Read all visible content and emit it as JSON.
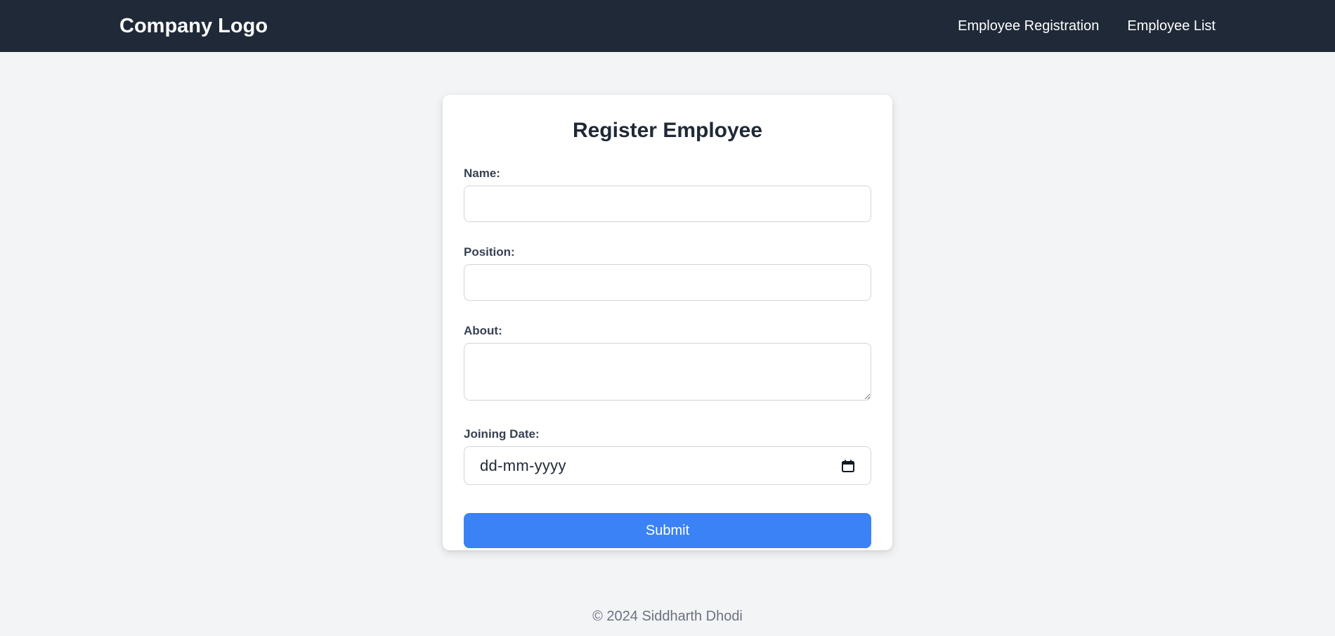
{
  "header": {
    "logo": "Company Logo",
    "nav": [
      {
        "label": "Employee Registration"
      },
      {
        "label": "Employee List"
      }
    ]
  },
  "form": {
    "title": "Register Employee",
    "name_label": "Name:",
    "name_value": "",
    "position_label": "Position:",
    "position_value": "",
    "about_label": "About:",
    "about_value": "",
    "date_label": "Joining Date:",
    "date_placeholder": "dd-mm-yyyy",
    "date_icon": "calendar-icon",
    "submit_label": "Submit"
  },
  "footer": {
    "text": "© 2024 Siddharth Dhodi"
  },
  "colors": {
    "navbar": "#1f2937",
    "background": "#f3f4f6",
    "accent": "#3b82f6"
  }
}
